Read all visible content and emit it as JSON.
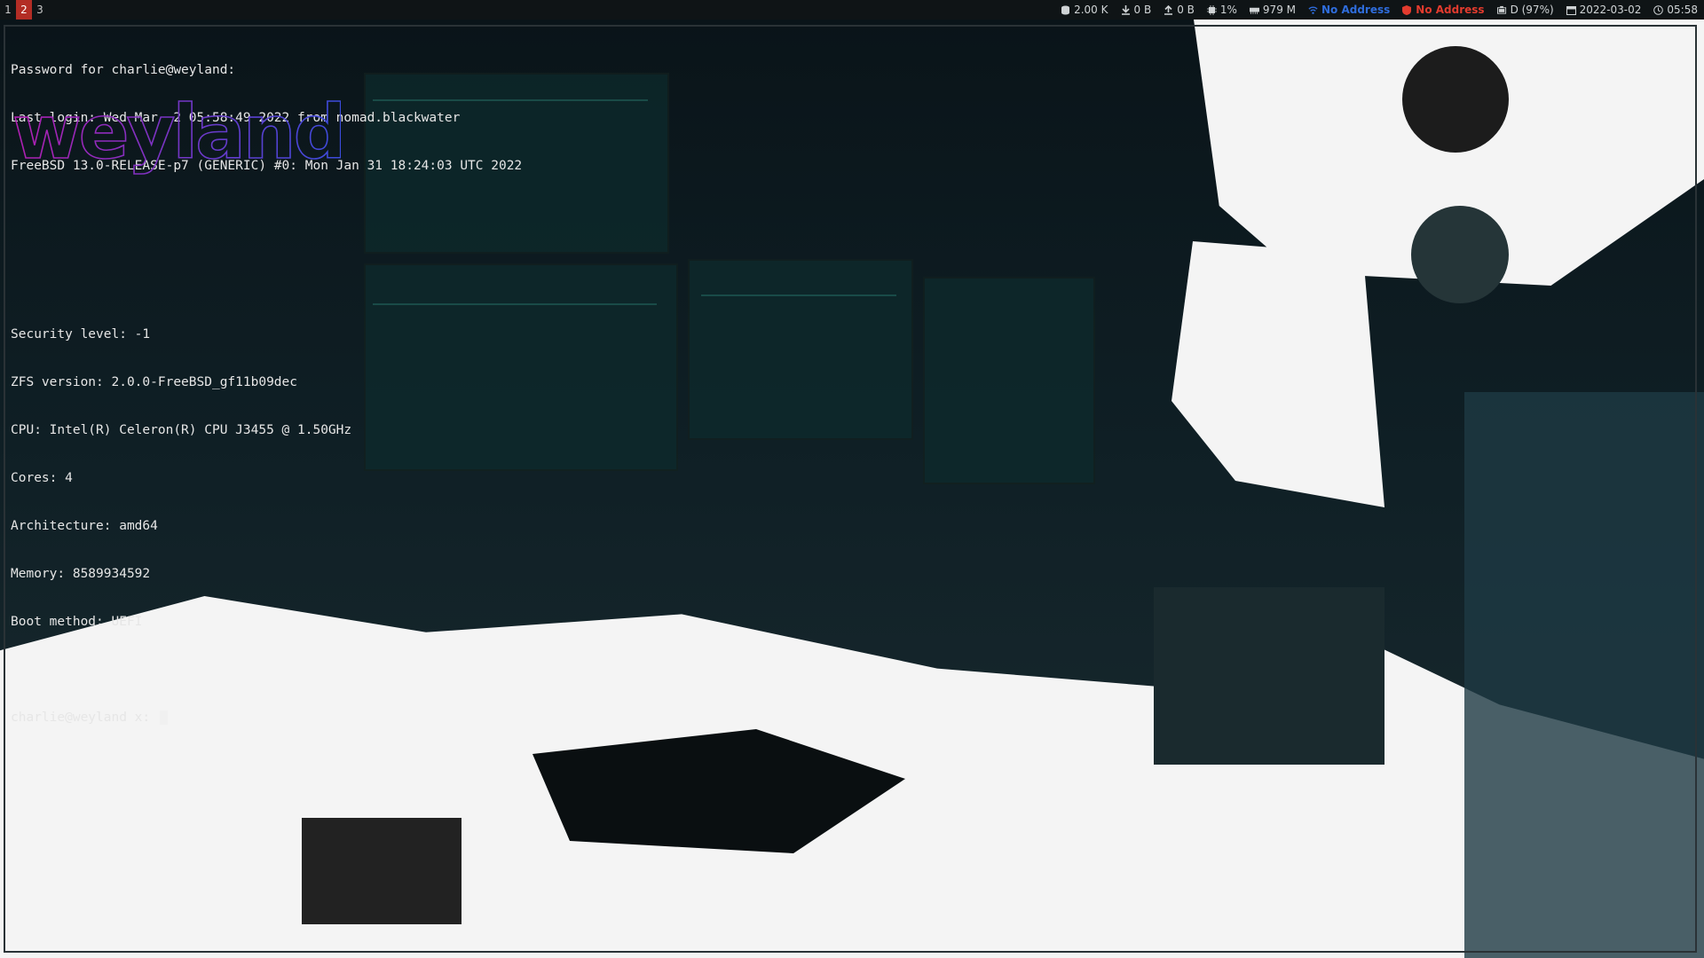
{
  "statusbar": {
    "workspaces": [
      {
        "label": "1",
        "active": false
      },
      {
        "label": "2",
        "active": true
      },
      {
        "label": "3",
        "active": false
      }
    ],
    "blocks": [
      {
        "icon": "database-icon",
        "text": "2.00 K"
      },
      {
        "icon": "download-icon",
        "text": "0 B"
      },
      {
        "icon": "upload-icon",
        "text": "0 B"
      },
      {
        "icon": "cpu-icon",
        "text": "1%"
      },
      {
        "icon": "memory-icon",
        "text": "979 M"
      },
      {
        "icon": "wifi-icon",
        "text": "No Address",
        "color": "#2f6ddc"
      },
      {
        "icon": "shield-icon",
        "text": "No Address",
        "color": "#e23b2e"
      },
      {
        "icon": "battery-icon",
        "text": "D (97%)"
      },
      {
        "icon": "calendar-icon",
        "text": "2022-03-02"
      },
      {
        "icon": "clock-icon",
        "text": "05:58"
      }
    ]
  },
  "terminal": {
    "lines": [
      "Password for charlie@weyland:",
      "Last login: Wed Mar  2 05:58:49 2022 from nomad.blackwater",
      "FreeBSD 13.0-RELEASE-p7 (GENERIC) #0: Mon Jan 31 18:24:03 UTC 2022"
    ],
    "logo_text": "weyland",
    "info": [
      "Security level: -1",
      "ZFS version: 2.0.0-FreeBSD_gf11b09dec",
      "CPU: Intel(R) Celeron(R) CPU J3455 @ 1.50GHz",
      "Cores: 4",
      "Architecture: amd64",
      "Memory: 8589934592",
      "Boot method: UEFI"
    ],
    "prompt": "charlie@weyland x: "
  },
  "colors": {
    "active_workspace": "#b32d25",
    "logo_gradient_start": "#b01fb0",
    "logo_gradient_end": "#3a4cdc"
  }
}
